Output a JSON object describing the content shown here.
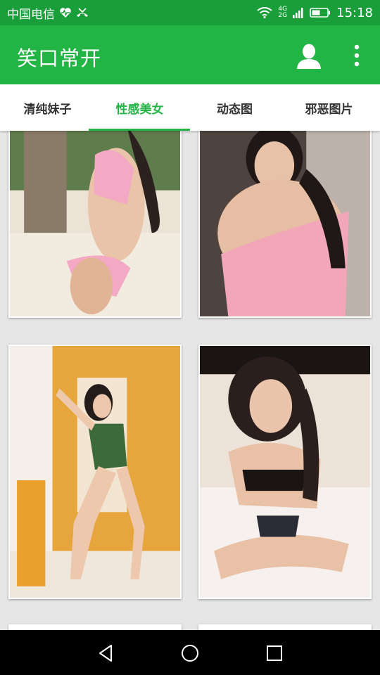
{
  "status_bar": {
    "carrier": "中国电信",
    "network_top": "4G",
    "network_bottom": "2G",
    "time": "15:18",
    "icons": [
      "heart-monitor-icon",
      "missed-call-icon",
      "wifi-icon",
      "signal-icon",
      "battery-icon"
    ]
  },
  "app_bar": {
    "title": "笑口常开",
    "icons": [
      "account-icon",
      "more-vert-icon"
    ]
  },
  "tabs": [
    {
      "label": "清纯妹子",
      "active": false
    },
    {
      "label": "性感美女",
      "active": true
    },
    {
      "label": "动态图",
      "active": false
    },
    {
      "label": "邪恶图片",
      "active": false
    }
  ],
  "photo_grid": {
    "items": [
      {
        "name": "photo-1",
        "bg": "#e9dfcf"
      },
      {
        "name": "photo-2",
        "bg": "#6b5a52"
      },
      {
        "name": "photo-3",
        "bg": "#e0a640"
      },
      {
        "name": "photo-4",
        "bg": "#e8dcd2"
      }
    ]
  },
  "nav_bar": {
    "icons": [
      "back-icon",
      "home-icon",
      "recents-icon"
    ]
  },
  "colors": {
    "status_bar": "#1a9e3a",
    "app_bar": "#22b444",
    "accent": "#22b444",
    "background": "#e6e6e6"
  }
}
